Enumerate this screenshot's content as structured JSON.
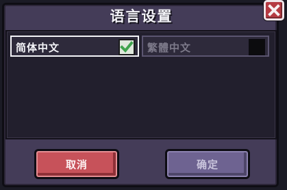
{
  "dialog": {
    "title": "语言设置",
    "close_icon": "close-icon"
  },
  "options": [
    {
      "label": "简体中文",
      "checked": true,
      "icon": "checkmark-icon"
    },
    {
      "label": "繁體中文",
      "checked": false
    }
  ],
  "buttons": {
    "cancel_label": "取消",
    "confirm_label": "确定"
  },
  "colors": {
    "frame": "#443c58",
    "panel": "#221f2d",
    "cancel": "#c7525a",
    "confirm": "#6e6391",
    "check": "#3fa34d",
    "close": "#b53a42"
  }
}
